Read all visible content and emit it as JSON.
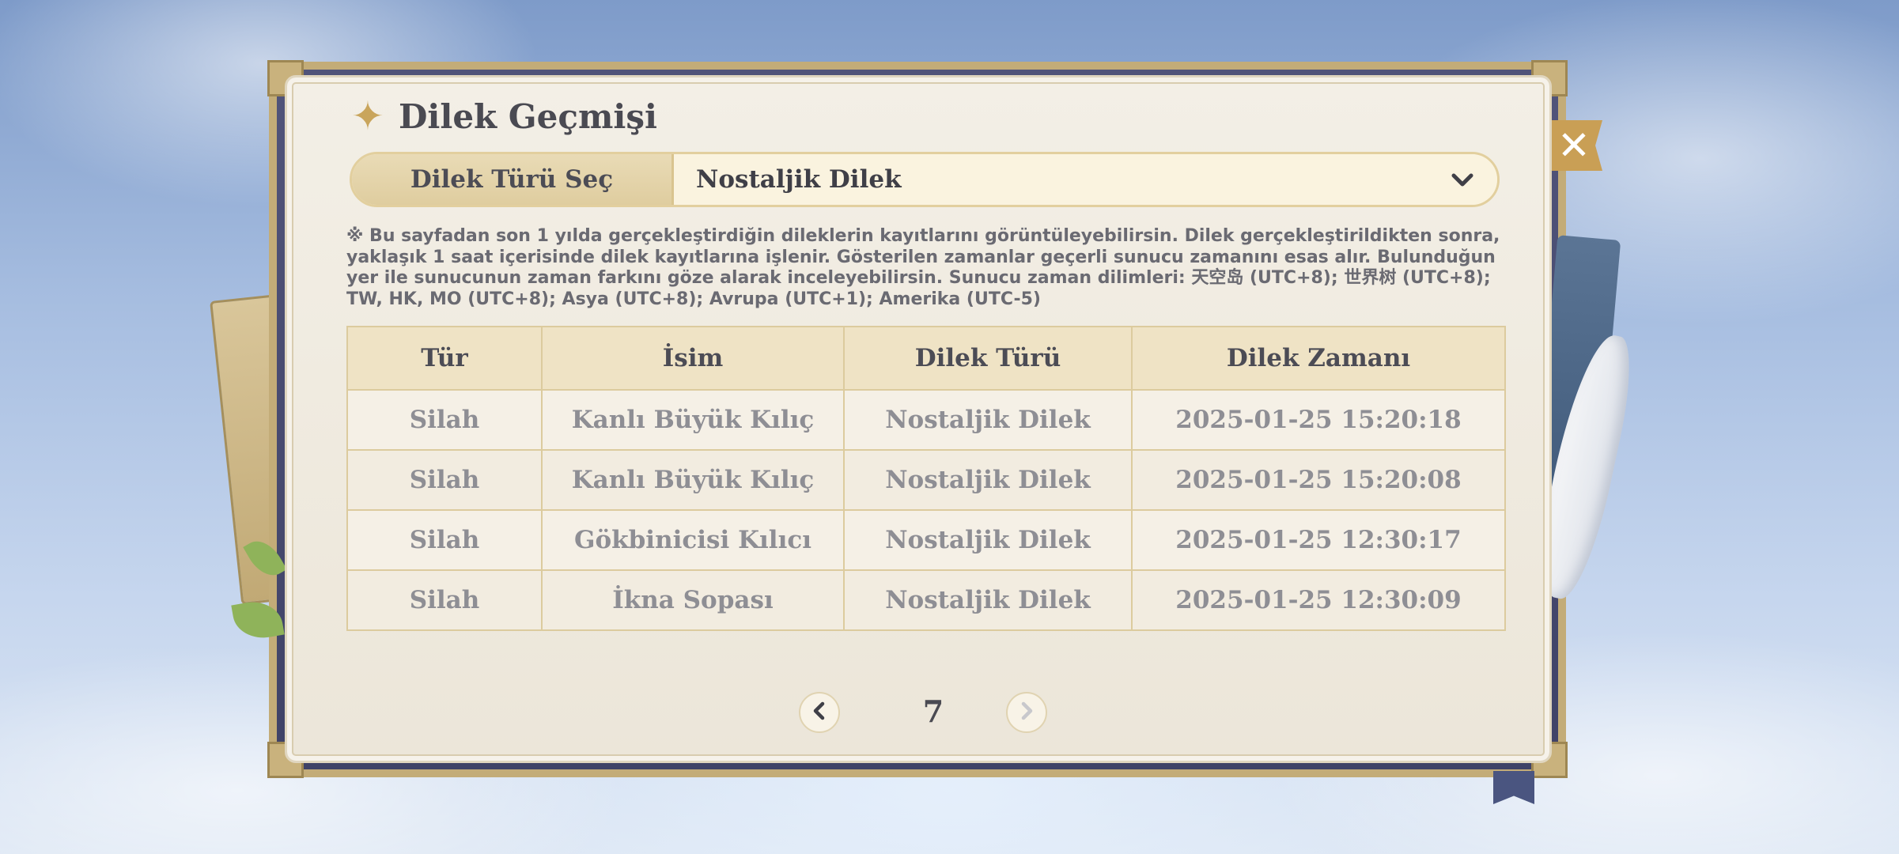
{
  "window": {
    "title": "Dilek Geçmişi",
    "close_icon": "close-icon"
  },
  "selector": {
    "label": "Dilek Türü Seç",
    "value": "Nostaljik Dilek"
  },
  "notice": "※ Bu sayfadan son 1 yılda gerçekleştirdiğin dileklerin kayıtlarını görüntüleyebilirsin. Dilek gerçekleştirildikten sonra, yaklaşık 1 saat içerisinde dilek kayıtlarına işlenir. Gösterilen zamanlar geçerli sunucu zamanını esas alır. Bulunduğun yer ile sunucunun zaman farkını göze alarak inceleyebilirsin. Sunucu zaman dilimleri: 天空岛 (UTC+8); 世界树 (UTC+8); TW, HK, MO (UTC+8); Asya (UTC+8); Avrupa (UTC+1); Amerika (UTC-5)",
  "table": {
    "headers": [
      "Tür",
      "İsim",
      "Dilek Türü",
      "Dilek Zamanı"
    ],
    "rows": [
      [
        "Silah",
        "Kanlı Büyük Kılıç",
        "Nostaljik Dilek",
        "2025-01-25 15:20:18"
      ],
      [
        "Silah",
        "Kanlı Büyük Kılıç",
        "Nostaljik Dilek",
        "2025-01-25 15:20:08"
      ],
      [
        "Silah",
        "Gökbinicisi Kılıcı",
        "Nostaljik Dilek",
        "2025-01-25 12:30:17"
      ],
      [
        "Silah",
        "İkna Sopası",
        "Nostaljik Dilek",
        "2025-01-25 12:30:09"
      ]
    ]
  },
  "pagination": {
    "current_page": "7"
  },
  "colors": {
    "accent_gold": "#c99f55",
    "title_text": "#4a4a52",
    "cell_text": "#8e8e94"
  }
}
